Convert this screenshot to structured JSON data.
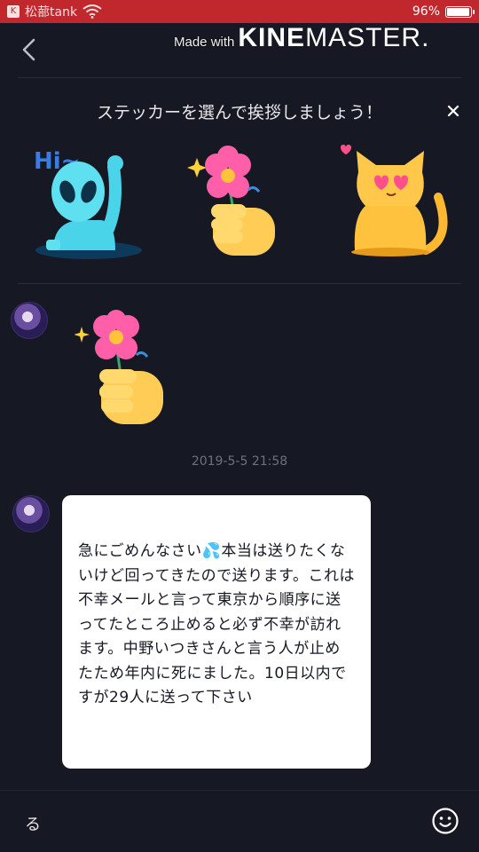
{
  "status_bar": {
    "left_text": "松蔀tank",
    "battery_percent": "96%",
    "battery_level": 0.96
  },
  "header": {
    "watermark_made_with": "Made with",
    "watermark_brand_bold": "KINE",
    "watermark_brand_light": "MASTER."
  },
  "sticker_panel": {
    "title": "ステッカーを選んで挨拶しましょう！",
    "stickers": [
      {
        "icon": "alien-hi-sticker-icon",
        "text": "Hi~"
      },
      {
        "icon": "flower-hand-sticker-icon"
      },
      {
        "icon": "heart-eyes-cat-sticker-icon"
      }
    ]
  },
  "messages": {
    "timestamp": "2019-5-5 21:58",
    "text_before_emoji": "急にごめんなさい",
    "emoji": "💦",
    "text_after_emoji": "本当は送りたくないけど回ってきたので送ります。これは不幸メールと言って東京から順序に送ってたところ止めると必ず不幸が訪れます。中野いつきさんと言う人が止めたため年内に死にました。10日以内ですが29人に送って下さい"
  },
  "input_bar": {
    "value": "る"
  },
  "colors": {
    "background": "#161823",
    "status_bar": "#c0282d",
    "bubble": "#ffffff",
    "timestamp": "#6e707c"
  }
}
